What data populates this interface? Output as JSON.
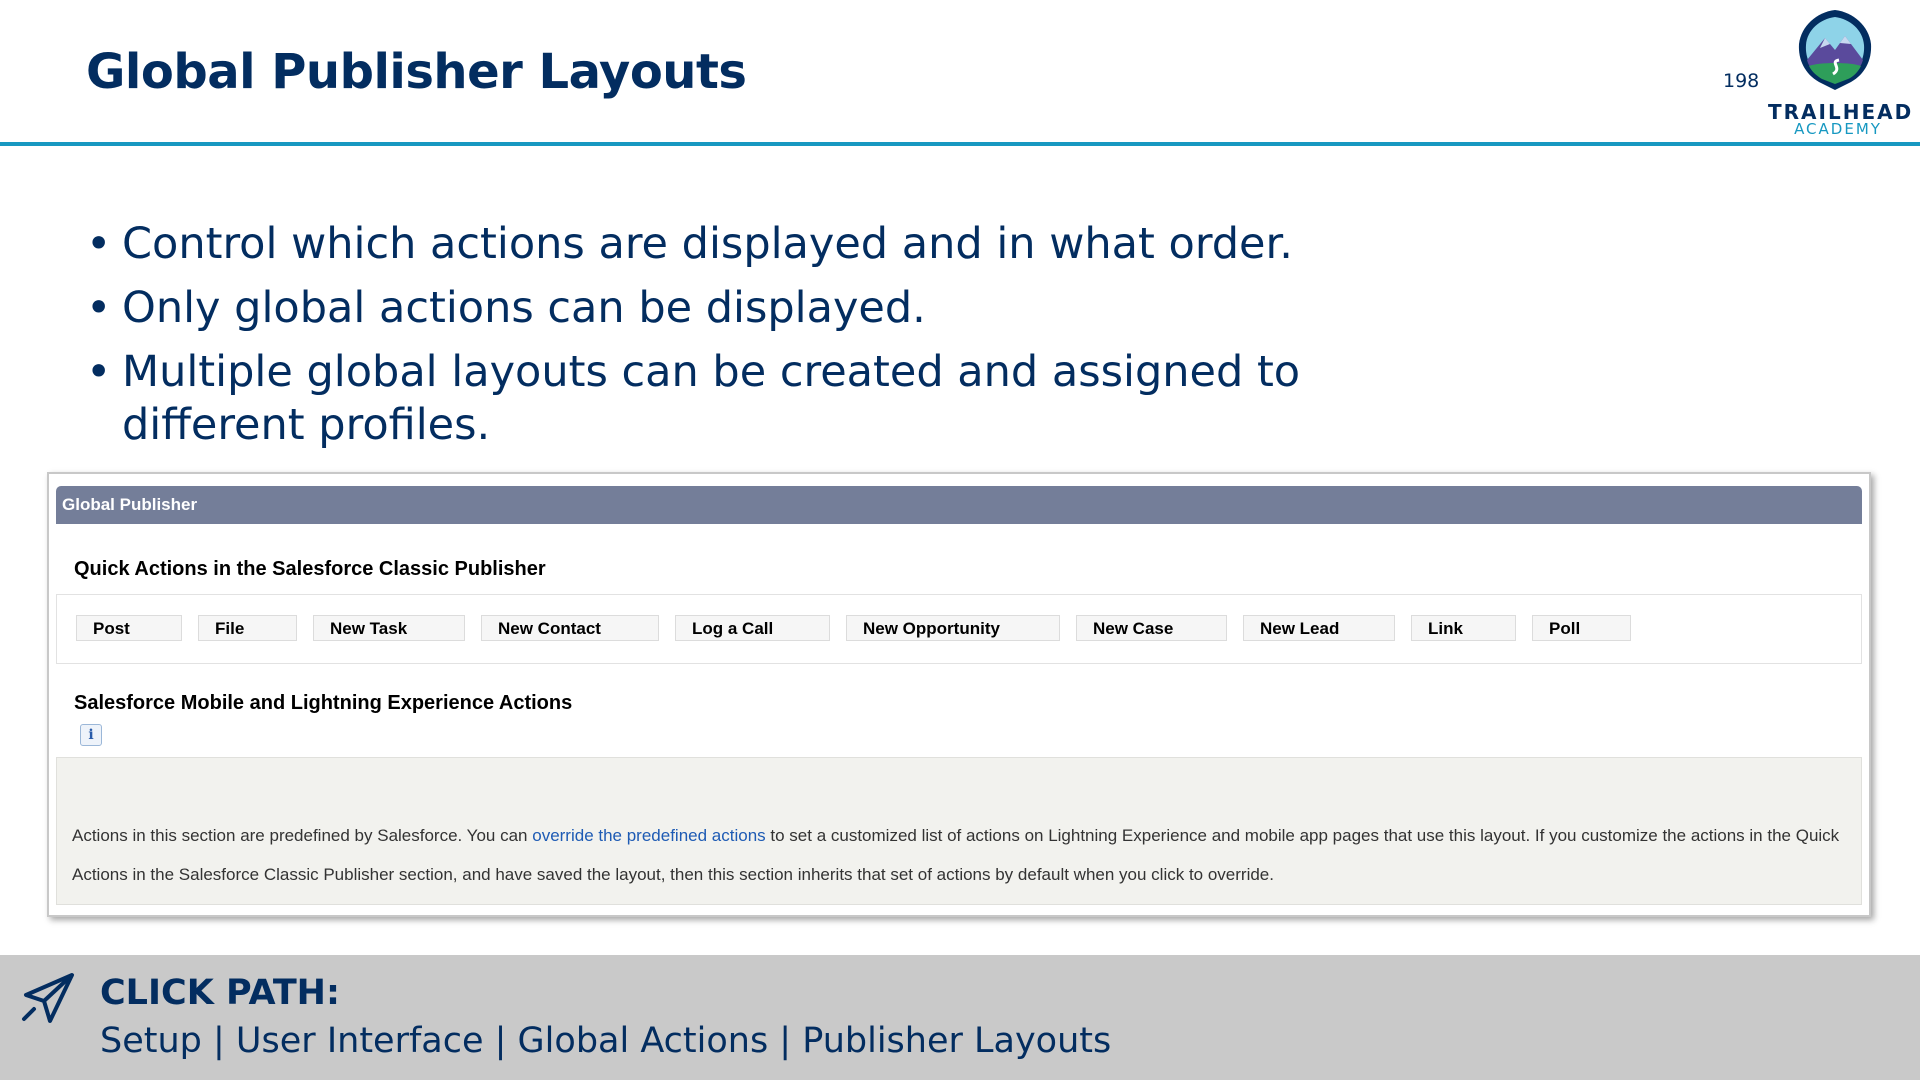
{
  "slide": {
    "title": "Global Publisher Layouts",
    "page_number": "198",
    "logo": {
      "line1": "TRAILHEAD",
      "line2": "ACADEMY"
    }
  },
  "bullets": [
    "Control which actions are displayed and in what order.",
    "Only global actions can be displayed.",
    "Multiple global layouts can be created and assigned to different profiles."
  ],
  "screenshot": {
    "header": "Global Publisher",
    "quick_actions_title": "Quick Actions in the Salesforce Classic Publisher",
    "quick_actions": [
      "Post",
      "File",
      "New Task",
      "New Contact",
      "Log a Call",
      "New Opportunity",
      "New Case",
      "New Lead",
      "Link",
      "Poll"
    ],
    "mobile_title": "Salesforce Mobile and Lightning Experience Actions",
    "info_icon": "i",
    "mobile_text_before": "Actions in this section are predefined by Salesforce. You can ",
    "mobile_link": "override the predefined actions",
    "mobile_text_after": " to set a customized list of actions on Lightning Experience and mobile app pages that use this layout. If you customize the actions in the Quick Actions in the Salesforce Classic Publisher section, and have saved the layout, then this section inherits that set of actions by default when you click to override."
  },
  "footer": {
    "label": "CLICK PATH:",
    "path": "Setup | User Interface | Global Actions | Publisher Layouts",
    "icon": "paper-plane-icon"
  },
  "colors": {
    "title_navy": "#032d60",
    "rule_blue": "#1798c1",
    "publisher_header": "#747e99",
    "footer_gray": "#c9c9c9",
    "link_blue": "#1e5bb4"
  }
}
